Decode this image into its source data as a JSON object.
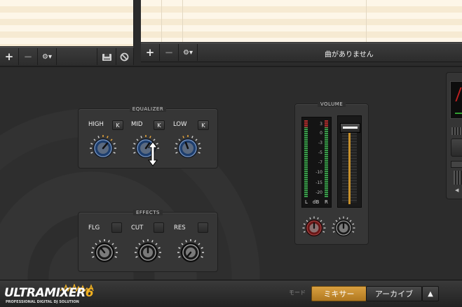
{
  "playlist_left": {
    "toolbar": {
      "add": "+",
      "remove": "−",
      "settings": "⚙▾"
    }
  },
  "playlist_right": {
    "toolbar": {
      "add": "+",
      "remove": "−",
      "settings": "⚙▾"
    },
    "status": "曲がありません"
  },
  "equalizer": {
    "title": "EQUALIZER",
    "bands": [
      {
        "label": "HIGH",
        "kill": "K"
      },
      {
        "label": "MID",
        "kill": "K"
      },
      {
        "label": "LOW",
        "kill": "K"
      }
    ]
  },
  "effects": {
    "title": "EFFECTS",
    "items": [
      {
        "label": "FLG"
      },
      {
        "label": "CUT"
      },
      {
        "label": "RES"
      }
    ]
  },
  "volume": {
    "title": "VOLUME",
    "scale": [
      "3",
      "0",
      "-3",
      "-5",
      "-7",
      "-10",
      "-15",
      "-20"
    ],
    "meter_left": "L",
    "meter_mid": "dB",
    "meter_right": "R",
    "fader_level": 0.98
  },
  "logo": {
    "name": "ULTRAMIXER",
    "version": "6",
    "tagline": "PROFESSIONAL DIGITAL DJ SOLUTION"
  },
  "mode": {
    "label": "モード",
    "mixer": "ミキサー",
    "archive": "アーカイブ",
    "expand": "▲"
  },
  "colors": {
    "accent_mode": "#c8912a",
    "eq_knob": "#1d3e6e",
    "gain_knob": "#6a1616"
  }
}
